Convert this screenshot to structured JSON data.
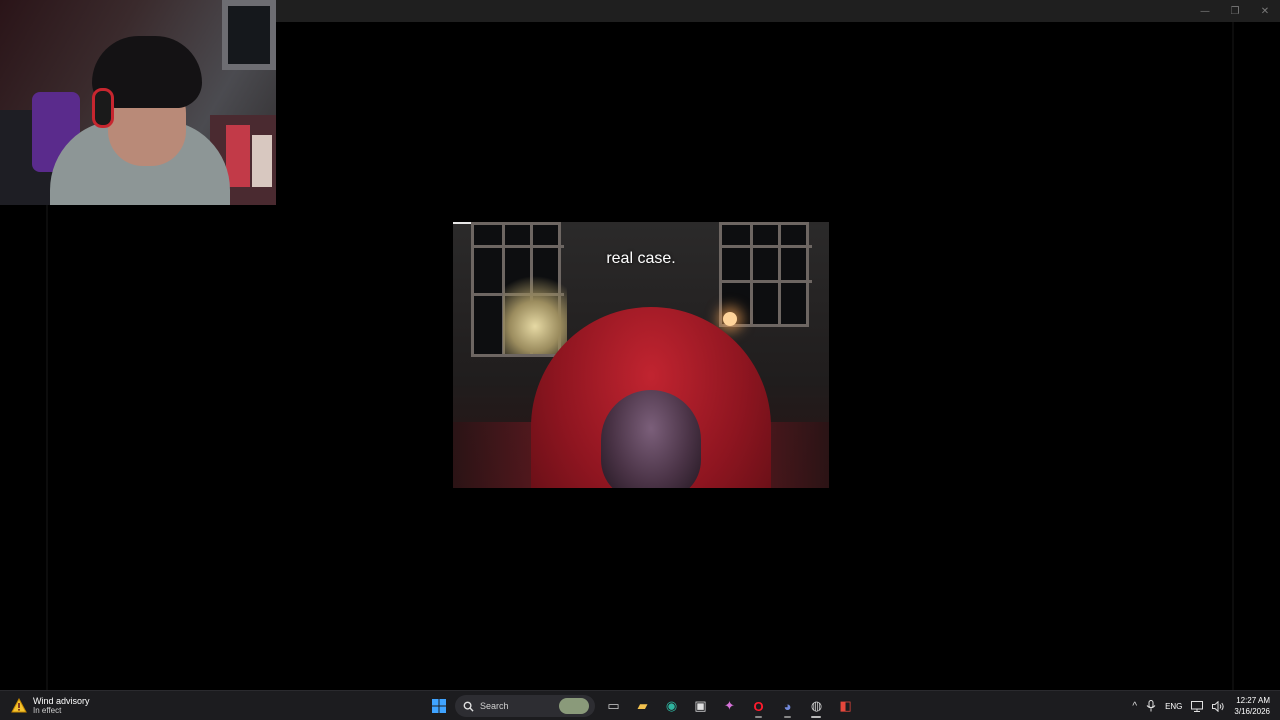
{
  "window": {
    "controls": {
      "minimize": "—",
      "restore": "❐",
      "close": "✕"
    }
  },
  "video": {
    "caption": "real case.",
    "progress_fraction": 0.1
  },
  "taskbar": {
    "weather": {
      "icon": "warning-weather-icon",
      "title": "Wind advisory",
      "subtitle": "In effect"
    },
    "search": {
      "label": "Search"
    },
    "apps": [
      {
        "name": "start-button",
        "glyph": "⊞",
        "color": "#3fa3ff"
      },
      {
        "name": "task-view-button",
        "glyph": "▭",
        "color": "#d0d0d0"
      },
      {
        "name": "file-explorer-icon",
        "glyph": "▰",
        "color": "#f2c14e"
      },
      {
        "name": "edge-browser-icon",
        "glyph": "◉",
        "color": "#2fb5a0"
      },
      {
        "name": "store-icon",
        "glyph": "▣",
        "color": "#e0e0e0"
      },
      {
        "name": "copilot-icon",
        "glyph": "✦",
        "color": "#d672d8"
      },
      {
        "name": "opera-browser-icon",
        "glyph": "O",
        "color": "#ff1b2d"
      },
      {
        "name": "discord-icon",
        "glyph": "◕",
        "color": "#7289da"
      },
      {
        "name": "obs-icon",
        "glyph": "◍",
        "color": "#cfcfcf"
      },
      {
        "name": "streaming-app-icon",
        "glyph": "◧",
        "color": "#e5473c"
      }
    ],
    "tray": {
      "chevron": "^",
      "mic": "🎙",
      "language": "ENG",
      "network": "🖵",
      "volume": "🔊",
      "time": "12:27 AM",
      "date": "3/16/2026"
    }
  }
}
